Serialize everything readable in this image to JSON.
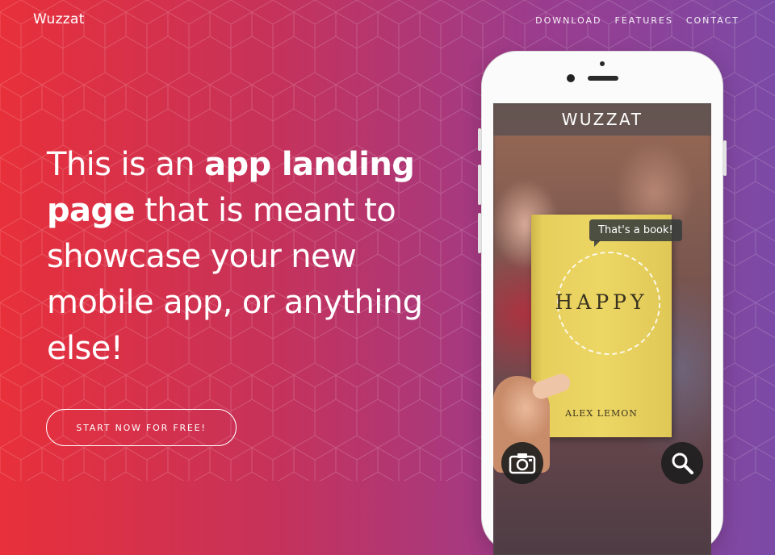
{
  "brand": "Wuzzat",
  "nav": {
    "items": [
      "DOWNLOAD",
      "FEATURES",
      "CONTACT"
    ]
  },
  "hero": {
    "headline_1": "This is an ",
    "headline_bold_1": "app landing page",
    "headline_2": " that is meant to showcase your new mobile app, or anything else!",
    "cta_label": "START NOW FOR FREE!"
  },
  "phone": {
    "app_title": "WUZZAT",
    "bubble_text": "That's a book!",
    "book_title": "HAPPY",
    "book_author": "ALEX LEMON",
    "camera_button_icon": "camera-icon",
    "search_button_icon": "search-icon"
  },
  "colors": {
    "gradient_start": "#e8303a",
    "gradient_end": "#7b4aa6",
    "book": "#ecd664"
  }
}
